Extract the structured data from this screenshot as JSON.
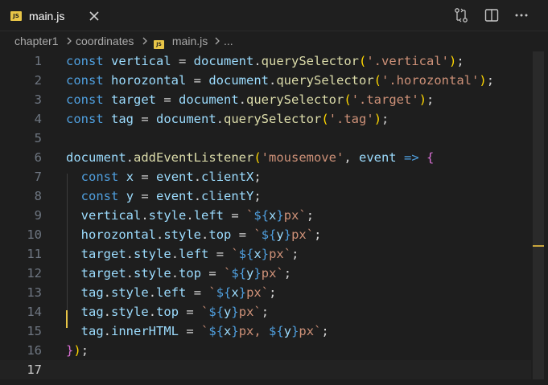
{
  "tab": {
    "badge": "JS",
    "title": "main.js"
  },
  "icons": {
    "file_type": "javascript-file-icon",
    "close": "close-icon",
    "compare_changes": "compare-changes-icon",
    "split_editor": "split-editor-icon",
    "more_actions": "more-actions-icon",
    "breadcrumb_separator": "chevron-right-icon"
  },
  "breadcrumb": {
    "items": [
      "chapter1",
      "coordinates",
      "main.js",
      "..."
    ],
    "badge": "JS"
  },
  "editor": {
    "line_numbers": [
      "1",
      "2",
      "3",
      "4",
      "5",
      "6",
      "7",
      "8",
      "9",
      "10",
      "11",
      "12",
      "13",
      "14",
      "15",
      "16",
      "17"
    ],
    "active_line": "17",
    "lines": [
      [
        [
          "k",
          "const"
        ],
        [
          "d",
          " "
        ],
        [
          "v",
          "vertical"
        ],
        [
          "d",
          " = "
        ],
        [
          "v",
          "document"
        ],
        [
          "d",
          "."
        ],
        [
          "f",
          "querySelector"
        ],
        [
          "p1",
          "("
        ],
        [
          "s",
          "'.vertical'"
        ],
        [
          "p1",
          ")"
        ],
        [
          "d",
          ";"
        ]
      ],
      [
        [
          "k",
          "const"
        ],
        [
          "d",
          " "
        ],
        [
          "v",
          "horozontal"
        ],
        [
          "d",
          " = "
        ],
        [
          "v",
          "document"
        ],
        [
          "d",
          "."
        ],
        [
          "f",
          "querySelector"
        ],
        [
          "p1",
          "("
        ],
        [
          "s",
          "'.horozontal'"
        ],
        [
          "p1",
          ")"
        ],
        [
          "d",
          ";"
        ]
      ],
      [
        [
          "k",
          "const"
        ],
        [
          "d",
          " "
        ],
        [
          "v",
          "target"
        ],
        [
          "d",
          " = "
        ],
        [
          "v",
          "document"
        ],
        [
          "d",
          "."
        ],
        [
          "f",
          "querySelector"
        ],
        [
          "p1",
          "("
        ],
        [
          "s",
          "'.target'"
        ],
        [
          "p1",
          ")"
        ],
        [
          "d",
          ";"
        ]
      ],
      [
        [
          "k",
          "const"
        ],
        [
          "d",
          " "
        ],
        [
          "v",
          "tag"
        ],
        [
          "d",
          " = "
        ],
        [
          "v",
          "document"
        ],
        [
          "d",
          "."
        ],
        [
          "f",
          "querySelector"
        ],
        [
          "p1",
          "("
        ],
        [
          "s",
          "'.tag'"
        ],
        [
          "p1",
          ")"
        ],
        [
          "d",
          ";"
        ]
      ],
      [],
      [
        [
          "v",
          "document"
        ],
        [
          "d",
          "."
        ],
        [
          "f",
          "addEventListener"
        ],
        [
          "p1",
          "("
        ],
        [
          "s",
          "'mousemove'"
        ],
        [
          "d",
          ", "
        ],
        [
          "v",
          "event"
        ],
        [
          "d",
          " "
        ],
        [
          "k",
          "=>"
        ],
        [
          "d",
          " "
        ],
        [
          "p2",
          "{"
        ]
      ],
      [
        [
          "d",
          "  "
        ],
        [
          "k",
          "const"
        ],
        [
          "d",
          " "
        ],
        [
          "v",
          "x"
        ],
        [
          "d",
          " = "
        ],
        [
          "v",
          "event"
        ],
        [
          "d",
          "."
        ],
        [
          "v",
          "clientX"
        ],
        [
          "d",
          ";"
        ]
      ],
      [
        [
          "d",
          "  "
        ],
        [
          "k",
          "const"
        ],
        [
          "d",
          " "
        ],
        [
          "v",
          "y"
        ],
        [
          "d",
          " = "
        ],
        [
          "v",
          "event"
        ],
        [
          "d",
          "."
        ],
        [
          "v",
          "clientY"
        ],
        [
          "d",
          ";"
        ]
      ],
      [
        [
          "d",
          "  "
        ],
        [
          "v",
          "vertical"
        ],
        [
          "d",
          "."
        ],
        [
          "v",
          "style"
        ],
        [
          "d",
          "."
        ],
        [
          "v",
          "left"
        ],
        [
          "d",
          " = "
        ],
        [
          "s",
          "`"
        ],
        [
          "k",
          "${"
        ],
        [
          "v",
          "x"
        ],
        [
          "k",
          "}"
        ],
        [
          "s",
          "px`"
        ],
        [
          "d",
          ";"
        ]
      ],
      [
        [
          "d",
          "  "
        ],
        [
          "v",
          "horozontal"
        ],
        [
          "d",
          "."
        ],
        [
          "v",
          "style"
        ],
        [
          "d",
          "."
        ],
        [
          "v",
          "top"
        ],
        [
          "d",
          " = "
        ],
        [
          "s",
          "`"
        ],
        [
          "k",
          "${"
        ],
        [
          "v",
          "y"
        ],
        [
          "k",
          "}"
        ],
        [
          "s",
          "px`"
        ],
        [
          "d",
          ";"
        ]
      ],
      [
        [
          "d",
          "  "
        ],
        [
          "v",
          "target"
        ],
        [
          "d",
          "."
        ],
        [
          "v",
          "style"
        ],
        [
          "d",
          "."
        ],
        [
          "v",
          "left"
        ],
        [
          "d",
          " = "
        ],
        [
          "s",
          "`"
        ],
        [
          "k",
          "${"
        ],
        [
          "v",
          "x"
        ],
        [
          "k",
          "}"
        ],
        [
          "s",
          "px`"
        ],
        [
          "d",
          ";"
        ]
      ],
      [
        [
          "d",
          "  "
        ],
        [
          "v",
          "target"
        ],
        [
          "d",
          "."
        ],
        [
          "v",
          "style"
        ],
        [
          "d",
          "."
        ],
        [
          "v",
          "top"
        ],
        [
          "d",
          " = "
        ],
        [
          "s",
          "`"
        ],
        [
          "k",
          "${"
        ],
        [
          "v",
          "y"
        ],
        [
          "k",
          "}"
        ],
        [
          "s",
          "px`"
        ],
        [
          "d",
          ";"
        ]
      ],
      [
        [
          "d",
          "  "
        ],
        [
          "v",
          "tag"
        ],
        [
          "d",
          "."
        ],
        [
          "v",
          "style"
        ],
        [
          "d",
          "."
        ],
        [
          "v",
          "left"
        ],
        [
          "d",
          " = "
        ],
        [
          "s",
          "`"
        ],
        [
          "k",
          "${"
        ],
        [
          "v",
          "x"
        ],
        [
          "k",
          "}"
        ],
        [
          "s",
          "px`"
        ],
        [
          "d",
          ";"
        ]
      ],
      [
        [
          "d",
          "  "
        ],
        [
          "v",
          "tag"
        ],
        [
          "d",
          "."
        ],
        [
          "v",
          "style"
        ],
        [
          "d",
          "."
        ],
        [
          "v",
          "top"
        ],
        [
          "d",
          " = "
        ],
        [
          "s",
          "`"
        ],
        [
          "k",
          "${"
        ],
        [
          "v",
          "y"
        ],
        [
          "k",
          "}"
        ],
        [
          "s",
          "px`"
        ],
        [
          "d",
          ";"
        ]
      ],
      [
        [
          "d",
          "  "
        ],
        [
          "v",
          "tag"
        ],
        [
          "d",
          "."
        ],
        [
          "v",
          "innerHTML"
        ],
        [
          "d",
          " = "
        ],
        [
          "s",
          "`"
        ],
        [
          "k",
          "${"
        ],
        [
          "v",
          "x"
        ],
        [
          "k",
          "}"
        ],
        [
          "s",
          "px, "
        ],
        [
          "k",
          "${"
        ],
        [
          "v",
          "y"
        ],
        [
          "k",
          "}"
        ],
        [
          "s",
          "px`"
        ],
        [
          "d",
          ";"
        ]
      ],
      [
        [
          "p2",
          "}"
        ],
        [
          "p1",
          ")"
        ],
        [
          "d",
          ";"
        ]
      ],
      []
    ]
  },
  "colors": {
    "background": "#1e1e1e",
    "keyword": "#4f9fde",
    "variable": "#9cdcfe",
    "function": "#dcdcaa",
    "string": "#ce9178",
    "bracket_level1": "#ffd700",
    "bracket_level2": "#da70d6",
    "cursor": "#e8c547"
  }
}
